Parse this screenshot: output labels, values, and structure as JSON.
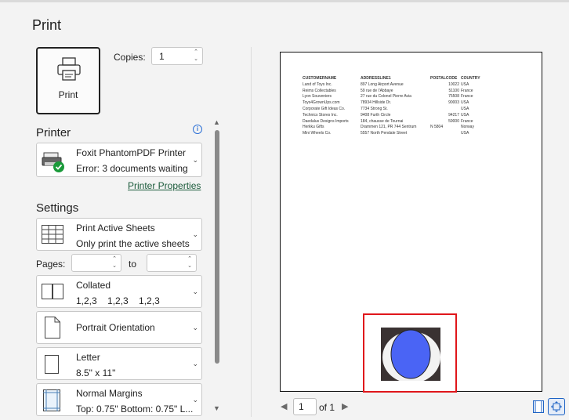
{
  "header": {
    "title": "Print"
  },
  "print_button": {
    "label": "Print"
  },
  "copies": {
    "label": "Copies:",
    "value": "1"
  },
  "printer": {
    "section_label": "Printer",
    "name": "Foxit PhantomPDF Printer",
    "status": "Error: 3 documents waiting",
    "properties_link": "Printer Properties"
  },
  "settings": {
    "section_label": "Settings",
    "sheets": {
      "title": "Print Active Sheets",
      "subtitle": "Only print the active sheets"
    },
    "pages": {
      "label": "Pages:",
      "from": "",
      "to_label": "to",
      "to": ""
    },
    "collate": {
      "title": "Collated",
      "subtitle": "1,2,3    1,2,3    1,2,3"
    },
    "orientation": {
      "title": "Portrait Orientation"
    },
    "paper": {
      "title": "Letter",
      "subtitle": "8.5\" x 11\""
    },
    "margins": {
      "title": "Normal Margins",
      "subtitle": "Top: 0.75\" Bottom: 0.75\" L..."
    }
  },
  "preview": {
    "headers": [
      "CUSTOMERNAME",
      "ADDRESSLINE1",
      "POSTALCODE",
      "COUNTRY"
    ],
    "rows": [
      [
        "Land of Toys Inc.",
        "897 Long Airport Avenue",
        "",
        "10022",
        "USA"
      ],
      [
        "Reims Collectables",
        "59 rue de l'Abbaye",
        "",
        "51100",
        "France"
      ],
      [
        "Lyon Souveniers",
        "27 rue du Colonel Pierre Avia",
        "",
        "75508",
        "France"
      ],
      [
        "Toys4GrownUps.com",
        "78934 Hillside Dr.",
        "",
        "90003",
        "USA"
      ],
      [
        "Corporate Gift Ideas Co.",
        "7734 Strong St.",
        "",
        "",
        "USA"
      ],
      [
        "Technics Stores Inc.",
        "9408 Furth Circle",
        "",
        "94217",
        "USA"
      ],
      [
        "Daedalus Designs Imports",
        "184, chausse de Tournai",
        "",
        "59000",
        "France"
      ],
      [
        "Herkku Gifts",
        "Drammen 121, PR 744 Sentrum",
        "N 5804",
        "",
        "Norway"
      ],
      [
        "Mini Wheels Co.",
        "5557 North Pendale Street",
        "",
        "",
        "USA"
      ]
    ],
    "page_number": "1",
    "of_label": "of 1"
  },
  "colors": {
    "accent": "#1d62c4",
    "highlight": "#e0161b",
    "link": "#1a5a3a"
  }
}
